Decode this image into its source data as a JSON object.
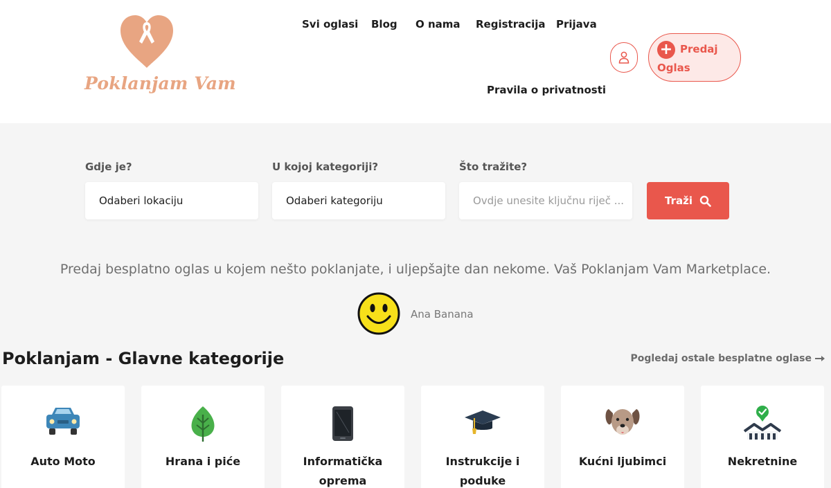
{
  "brand": {
    "name": "Poklanjam Vam",
    "color": "#e8a582"
  },
  "nav": {
    "items": [
      "Svi oglasi",
      "Blog",
      "O nama",
      "Registracija",
      "Prijava"
    ],
    "privacy": "Pravila o privatnosti",
    "post_line1": "Predaj",
    "post_line2": "Oglas",
    "accent": "#e9574c"
  },
  "search": {
    "location": {
      "label": "Gdje je?",
      "value": "Odaberi lokaciju"
    },
    "category": {
      "label": "U kojoj kategoriji?",
      "value": "Odaberi kategoriju"
    },
    "keyword": {
      "label": "Što tražite?",
      "placeholder": "Ovdje unesite ključnu riječ ..."
    },
    "button": "Traži"
  },
  "testimonial": {
    "text": "Predaj besplatno oglas u kojem nešto poklanjate, i uljepšajte dan nekome. Vaš Poklanjam Vam Marketplace.",
    "author": "Ana Banana"
  },
  "categories": {
    "title": "Poklanjam - Glavne kategorije",
    "more": "Pogledaj ostale besplatne oglase",
    "items": [
      {
        "icon": "car-icon",
        "line1": "Auto Moto",
        "line2": ""
      },
      {
        "icon": "leaf-icon",
        "line1": "Hrana i piće",
        "line2": ""
      },
      {
        "icon": "smartphone-icon",
        "line1": "Informatička",
        "line2": "oprema"
      },
      {
        "icon": "graduation-cap-icon",
        "line1": "Instrukcije i",
        "line2": "poduke"
      },
      {
        "icon": "dog-icon",
        "line1": "Kućni ljubimci",
        "line2": ""
      },
      {
        "icon": "houses-icon",
        "line1": "Nekretnine",
        "line2": ""
      }
    ]
  }
}
